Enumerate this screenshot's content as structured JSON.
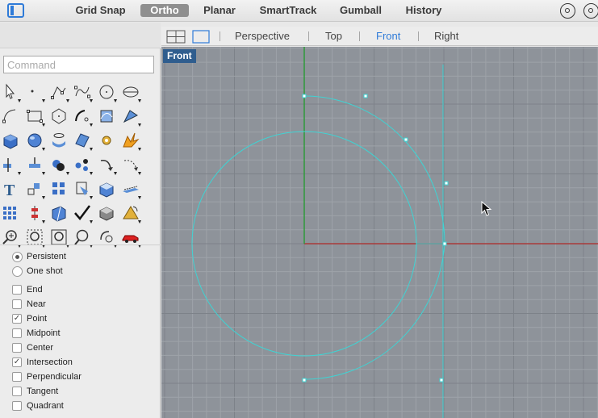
{
  "toolbar": {
    "buttons": [
      {
        "label": "Grid Snap",
        "active": false
      },
      {
        "label": "Ortho",
        "active": true
      },
      {
        "label": "Planar",
        "active": false
      },
      {
        "label": "SmartTrack",
        "active": false
      },
      {
        "label": "Gumball",
        "active": false
      },
      {
        "label": "History",
        "active": false
      }
    ],
    "panel_toggle_icon": "sidebar-toggle-icon",
    "right_icons": [
      "target-icon",
      "osnap-icon"
    ]
  },
  "command": {
    "placeholder": "Command",
    "value": ""
  },
  "tool_palette": {
    "rows": [
      [
        "select-arrow-icon",
        "point-icon",
        "polyline-icon",
        "curve-icon",
        "circle-icon",
        "ellipse-icon"
      ],
      [
        "arc-icon",
        "rectangle-icon",
        "polygon-icon",
        "freeform-curve-icon",
        "curve-edit-icon",
        "fillet-icon"
      ],
      [
        "box-solid-icon",
        "sphere-icon",
        "surface-patch-icon",
        "surface-icon",
        "gear-tools-icon",
        "explode-icon"
      ],
      [
        "split-icon",
        "trim-icon",
        "boolean-icon",
        "group-icon",
        "rotate-icon",
        "rebuild-icon"
      ],
      [
        "text-icon",
        "scale-icon",
        "array-icon",
        "dimension-icon",
        "extrude-icon",
        "project-icon"
      ],
      [
        "grid-array-icon",
        "gumball-icon",
        "shade-icon",
        "check-icon",
        "render-icon",
        "lights-icon"
      ],
      [
        "zoom-icon",
        "zoom-window-icon",
        "zoom-extents-icon",
        "zoom-selected-icon",
        "rotate-view-icon",
        "car-icon"
      ]
    ]
  },
  "osnap": {
    "mode": [
      {
        "label": "Persistent",
        "selected": true
      },
      {
        "label": "One shot",
        "selected": false
      }
    ],
    "snaps": [
      {
        "label": "End",
        "checked": false
      },
      {
        "label": "Near",
        "checked": false
      },
      {
        "label": "Point",
        "checked": true
      },
      {
        "label": "Midpoint",
        "checked": false
      },
      {
        "label": "Center",
        "checked": false
      },
      {
        "label": "Intersection",
        "checked": true
      },
      {
        "label": "Perpendicular",
        "checked": false
      },
      {
        "label": "Tangent",
        "checked": false
      },
      {
        "label": "Quadrant",
        "checked": false
      }
    ]
  },
  "viewport_tabs": {
    "layout_icons": [
      "four-view-layout-icon",
      "single-view-layout-icon"
    ],
    "tabs": [
      {
        "label": "Perspective",
        "active": false
      },
      {
        "label": "Top",
        "active": false
      },
      {
        "label": "Front",
        "active": true
      },
      {
        "label": "Right",
        "active": false
      }
    ]
  },
  "viewport": {
    "label": "Front",
    "background_color": "#8e939a",
    "grid_color": "#9ea3a9",
    "grid_major_color": "#7d8289",
    "x_axis_color": "#a83a3a",
    "y_axis_color": "#2f9a3a",
    "curve_color": "#3fd3d3"
  },
  "colors": {
    "accent": "#2f7bd8",
    "label_bg": "#2f5d8e"
  }
}
